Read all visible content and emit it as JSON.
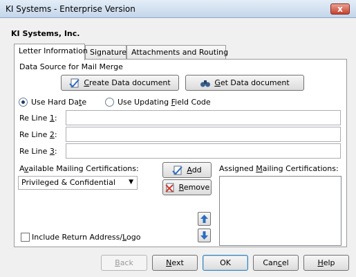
{
  "window": {
    "title": "KI Systems - Enterprise Version",
    "close_glyph": "x"
  },
  "header": {
    "company": "KI Systems, Inc."
  },
  "tabs": [
    {
      "label": "Letter Information",
      "active": true
    },
    {
      "label": "Signature",
      "active": false
    },
    {
      "label": "Attachments and Routing",
      "active": false
    }
  ],
  "mail_merge": {
    "heading": "Data Source for Mail Merge",
    "create": {
      "pre": "",
      "key": "C",
      "post": "reate Data document"
    },
    "get": {
      "pre": "",
      "key": "G",
      "post": "et Data document"
    }
  },
  "date_options": {
    "hard": {
      "pre": "Use Hard Da",
      "key": "t",
      "post": "e",
      "selected": true
    },
    "updating": {
      "pre": "Use Updating ",
      "key": "F",
      "post": "ield Code",
      "selected": false
    }
  },
  "re_lines": [
    {
      "pre": "Re Line ",
      "key": "1",
      "post": ":",
      "value": ""
    },
    {
      "pre": "Re Line ",
      "key": "2",
      "post": ":",
      "value": ""
    },
    {
      "pre": "Re Line ",
      "key": "3",
      "post": ":",
      "value": ""
    }
  ],
  "certifications": {
    "available_label": {
      "pre": "A",
      "key": "v",
      "post": "ailable Mailing Certifications:"
    },
    "assigned_label": {
      "pre": "Assigned ",
      "key": "M",
      "post": "ailing Certifications:"
    },
    "selected": "Privileged & Confidential",
    "add": {
      "pre": "",
      "key": "A",
      "post": "dd"
    },
    "remove": {
      "pre": "",
      "key": "R",
      "post": "emove"
    }
  },
  "include_return": {
    "pre": "Include Return Address/",
    "key": "L",
    "post": "ogo",
    "checked": false
  },
  "footer": {
    "back": {
      "pre": "",
      "key": "B",
      "post": "ack",
      "enabled": false
    },
    "next": {
      "pre": "",
      "key": "N",
      "post": "ext",
      "enabled": true
    },
    "ok": {
      "label": "OK"
    },
    "cancel": {
      "pre": "Can",
      "key": "c",
      "post": "el"
    },
    "help": {
      "pre": "",
      "key": "H",
      "post": "elp"
    }
  },
  "colors": {
    "titlebar": "#c4d6ea",
    "close": "#c6422f",
    "panel": "#ffffff",
    "dialog": "#f0f0f0"
  }
}
